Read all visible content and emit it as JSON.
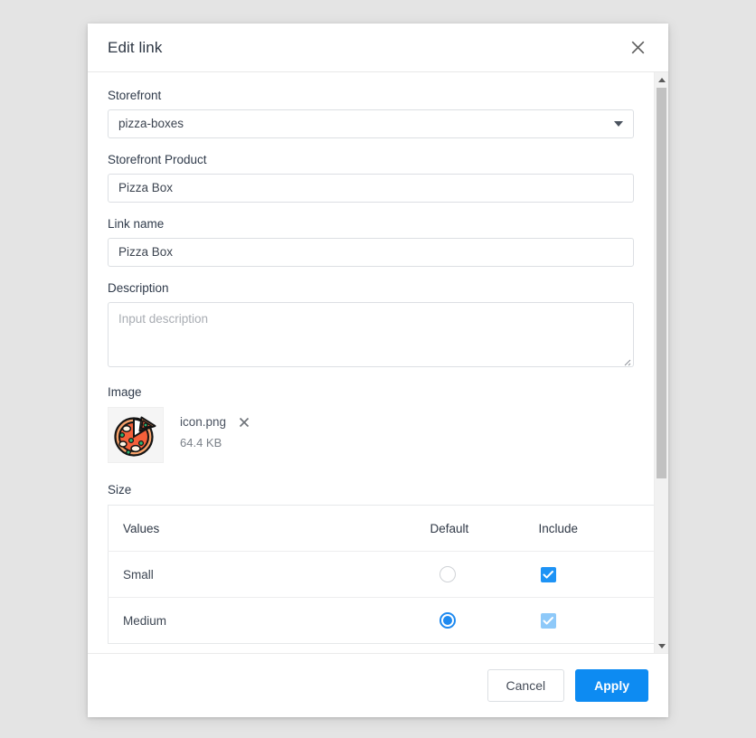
{
  "dialog": {
    "title": "Edit link",
    "close_icon": "close-icon"
  },
  "form": {
    "storefront": {
      "label": "Storefront",
      "value": "pizza-boxes",
      "caret_icon": "chevron-down-icon"
    },
    "storefront_product": {
      "label": "Storefront Product",
      "value": "Pizza Box"
    },
    "link_name": {
      "label": "Link name",
      "value": "Pizza Box"
    },
    "description": {
      "label": "Description",
      "value": "",
      "placeholder": "Input description"
    },
    "image": {
      "label": "Image",
      "thumbnail_icon": "pizza-icon",
      "file_name": "icon.png",
      "file_size": "64.4 KB",
      "remove_icon": "close-icon"
    },
    "size": {
      "label": "Size",
      "columns": [
        "Values",
        "Default",
        "Include"
      ],
      "rows": [
        {
          "value": "Small",
          "default": false,
          "include": true,
          "include_disabled": false
        },
        {
          "value": "Medium",
          "default": true,
          "include": true,
          "include_disabled": true
        }
      ]
    }
  },
  "footer": {
    "cancel_label": "Cancel",
    "apply_label": "Apply"
  },
  "colors": {
    "accent": "#0d8bf2",
    "checkbox": "#1e93f5",
    "checkbox_disabled": "#8ec9f9",
    "radio": "#1f8af0",
    "backdrop": "#e4e4e4",
    "title": "#2d3643"
  }
}
